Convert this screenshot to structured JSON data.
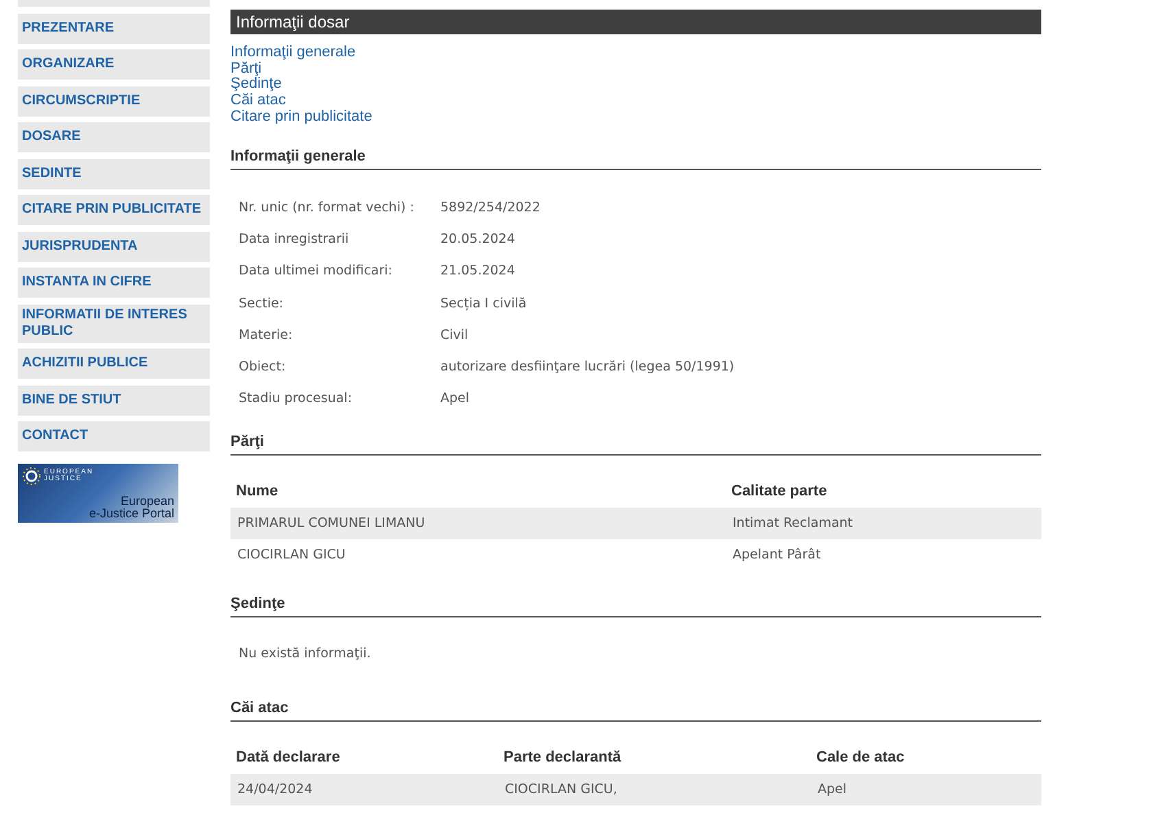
{
  "sidebar": {
    "items": [
      {
        "label": "PREZENTARE"
      },
      {
        "label": "ORGANIZARE"
      },
      {
        "label": "CIRCUMSCRIPTIE"
      },
      {
        "label": "DOSARE"
      },
      {
        "label": "SEDINTE"
      },
      {
        "label": "CITARE PRIN PUBLICITATE"
      },
      {
        "label": "JURISPRUDENTA"
      },
      {
        "label": "INSTANTA IN CIFRE"
      },
      {
        "label": "INFORMATII DE INTERES PUBLIC"
      },
      {
        "label": "ACHIZITII PUBLICE"
      },
      {
        "label": "BINE DE STIUT"
      },
      {
        "label": "CONTACT"
      }
    ],
    "banner": {
      "logo_top": "EUROPEAN",
      "logo_bottom": "JUSTICE",
      "title": "European",
      "subtitle": "e-Justice Portal"
    }
  },
  "panel": {
    "title": "Informaţii dosar",
    "links": [
      "Informaţii generale",
      "Părţi",
      "Şedinţe",
      "Căi atac",
      "Citare prin publicitate"
    ],
    "general": {
      "heading": "Informaţii generale",
      "fields": [
        {
          "label": "Nr. unic (nr. format vechi) :",
          "value": "5892/254/2022"
        },
        {
          "label": "Data inregistrarii",
          "value": "20.05.2024"
        },
        {
          "label": "Data ultimei modificari:",
          "value": "21.05.2024"
        },
        {
          "label": "Sectie:",
          "value": "Secția I civilă"
        },
        {
          "label": "Materie:",
          "value": "Civil"
        },
        {
          "label": "Obiect:",
          "value": "autorizare desfiinţare lucrări (legea 50/1991)"
        },
        {
          "label": "Stadiu procesual:",
          "value": "Apel"
        }
      ]
    },
    "parties": {
      "heading": "Părţi",
      "columns": [
        "Nume",
        "Calitate parte"
      ],
      "rows": [
        [
          "PRIMARUL COMUNEI LIMANU",
          "Intimat Reclamant"
        ],
        [
          "CIOCIRLAN GICU",
          "Apelant Pârât"
        ]
      ]
    },
    "hearings": {
      "heading": "Şedinţe",
      "empty": "Nu există informaţii."
    },
    "appeals": {
      "heading": "Căi atac",
      "columns": [
        "Dată declarare",
        "Parte declarantă",
        "Cale de atac"
      ],
      "rows": [
        [
          "24/04/2024",
          "CIOCIRLAN GICU,",
          "Apel"
        ]
      ]
    }
  }
}
